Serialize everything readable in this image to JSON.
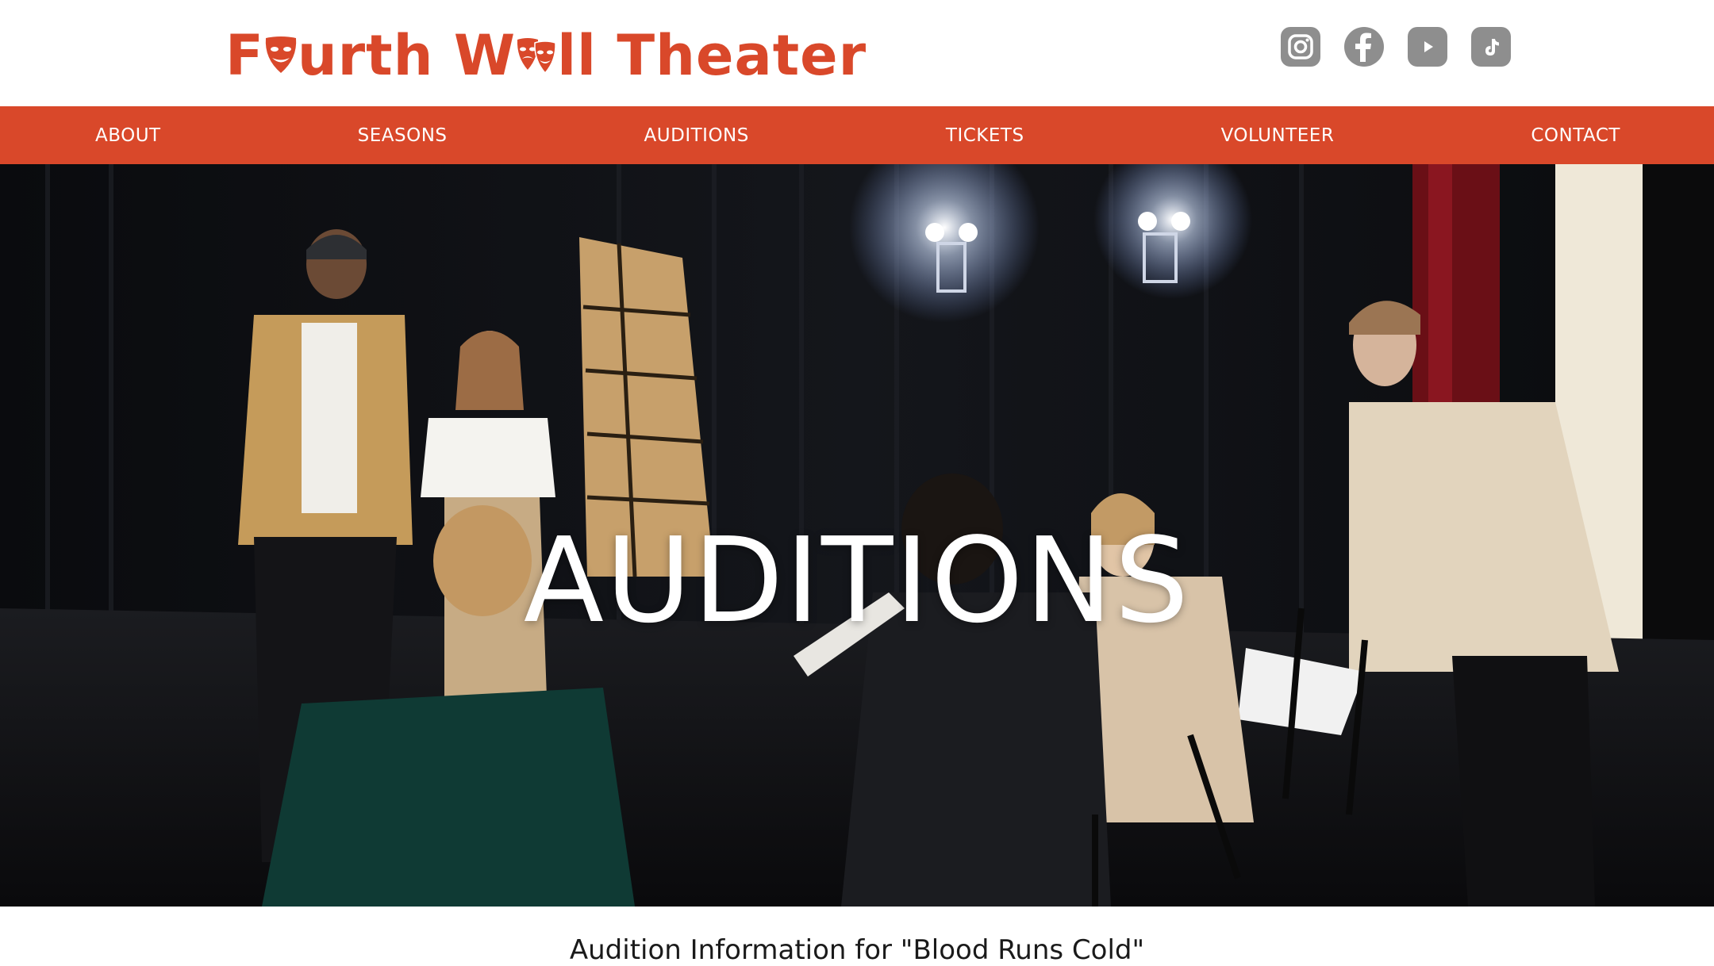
{
  "brand": {
    "name_part1": "F",
    "name_part2": "urth W",
    "name_part3": "ll Theater",
    "accent_color": "#d9482a"
  },
  "social": [
    {
      "icon": "instagram-icon"
    },
    {
      "icon": "facebook-icon"
    },
    {
      "icon": "youtube-icon"
    },
    {
      "icon": "tiktok-icon"
    }
  ],
  "nav": {
    "about": "ABOUT",
    "seasons": "SEASONS",
    "auditions": "AUDITIONS",
    "tickets": "TICKETS",
    "volunteer": "VOLUNTEER",
    "contact": "CONTACT"
  },
  "hero": {
    "title": "AUDITIONS"
  },
  "content": {
    "heading": "Audition Information for \"Blood Runs Cold\""
  }
}
